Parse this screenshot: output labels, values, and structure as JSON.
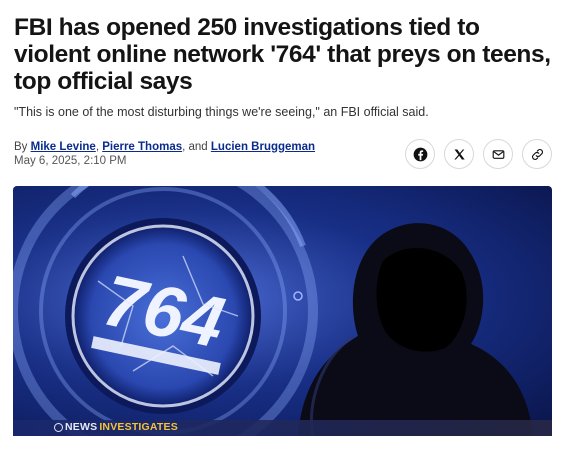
{
  "article": {
    "headline": "FBI has opened 250 investigations tied to violent online network '764' that preys on teens, top official says",
    "dek": "\"This is one of the most disturbing things we're seeing,\" an FBI official said.",
    "byline": {
      "prefix": "By ",
      "authors": [
        "Mike Levine",
        "Pierre Thomas",
        "Lucien Bruggeman"
      ],
      "sep1": ", ",
      "sep2": ", and ",
      "date": "May 6, 2025, 2:10 PM"
    }
  },
  "share": {
    "facebook": "facebook-icon",
    "x": "x-icon",
    "email": "email-icon",
    "link": "link-icon"
  },
  "hero": {
    "emblem_text": "764",
    "bar_prefix": "NEWS ",
    "bar_show": "INVESTIGATES",
    "colors": {
      "background": "#18308a",
      "emblem": "#eef3ff",
      "accent": "#f4c23a"
    }
  }
}
